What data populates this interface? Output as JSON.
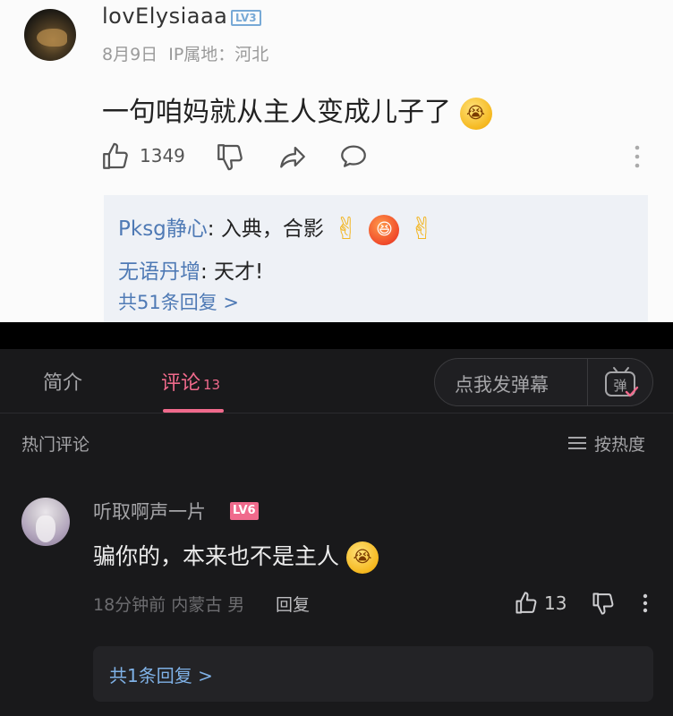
{
  "top_comment": {
    "username": "lovElysiaaa",
    "level_badge": "LV3",
    "date": "8月9日",
    "ip_location": "IP属地：河北",
    "text": "一句咱妈就从主人变成儿子了",
    "likes": "1349",
    "replies": [
      {
        "name": "Pksg静心",
        "text": ": 入典，合影"
      },
      {
        "name": "无语丹增",
        "text": ": 天才!"
      }
    ],
    "more_replies": "共51条回复 >"
  },
  "tabs": {
    "intro": "简介",
    "comments": "评论",
    "comments_count": "13",
    "danmaku_placeholder": "点我发弹幕",
    "danmaku_icon_label": "弹"
  },
  "section": {
    "hot_label": "热门评论",
    "sort_label": "按热度"
  },
  "comment": {
    "username": "听取啊声一片",
    "level_badge": "LV6",
    "text": "骗你的，本来也不是主人",
    "meta": "18分钟前 内蒙古 男",
    "reply_button": "回复",
    "likes": "13",
    "replies_link": "共1条回复 >"
  },
  "colors": {
    "accent": "#f06a8c",
    "link_blue": "#7fb1e6",
    "dark_bg": "#19191b"
  }
}
